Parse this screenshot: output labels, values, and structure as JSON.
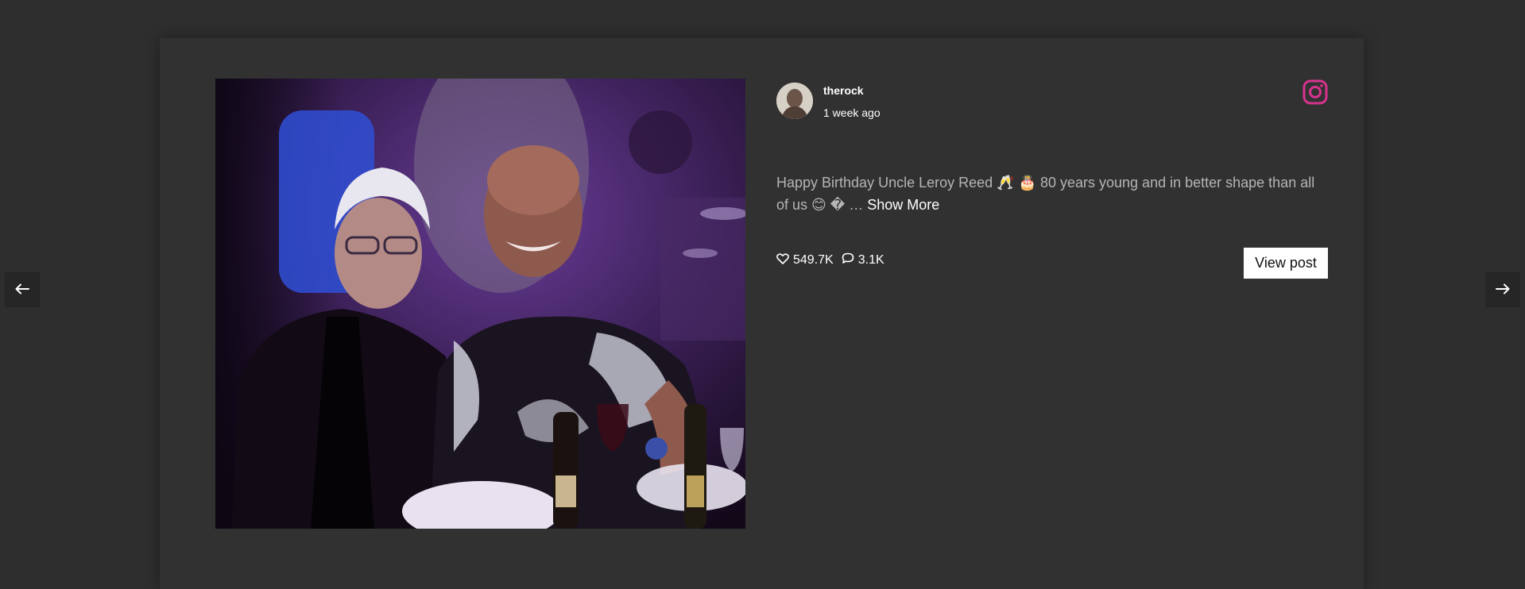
{
  "post": {
    "username": "therock",
    "timestamp": "1 week ago",
    "caption": "Happy Birthday Uncle Leroy Reed 🥂 🎂 80 years young and in better shape than all of us 😊 � …",
    "show_more_label": "Show More",
    "likes": "549.7K",
    "comments": "3.1K",
    "view_post_label": "View post",
    "photo_alt": "Two men seated at a dinner table"
  },
  "icons": {
    "platform": "instagram-icon",
    "like": "heart-icon",
    "comment": "comment-bubble-icon",
    "prev": "arrow-left-icon",
    "next": "arrow-right-icon"
  },
  "colors": {
    "page_background": "#2e2e2e",
    "modal_background": "#313131",
    "instagram_accent": "#d6338d",
    "caption_text": "#b5b5b5",
    "button_background": "#ffffff"
  }
}
